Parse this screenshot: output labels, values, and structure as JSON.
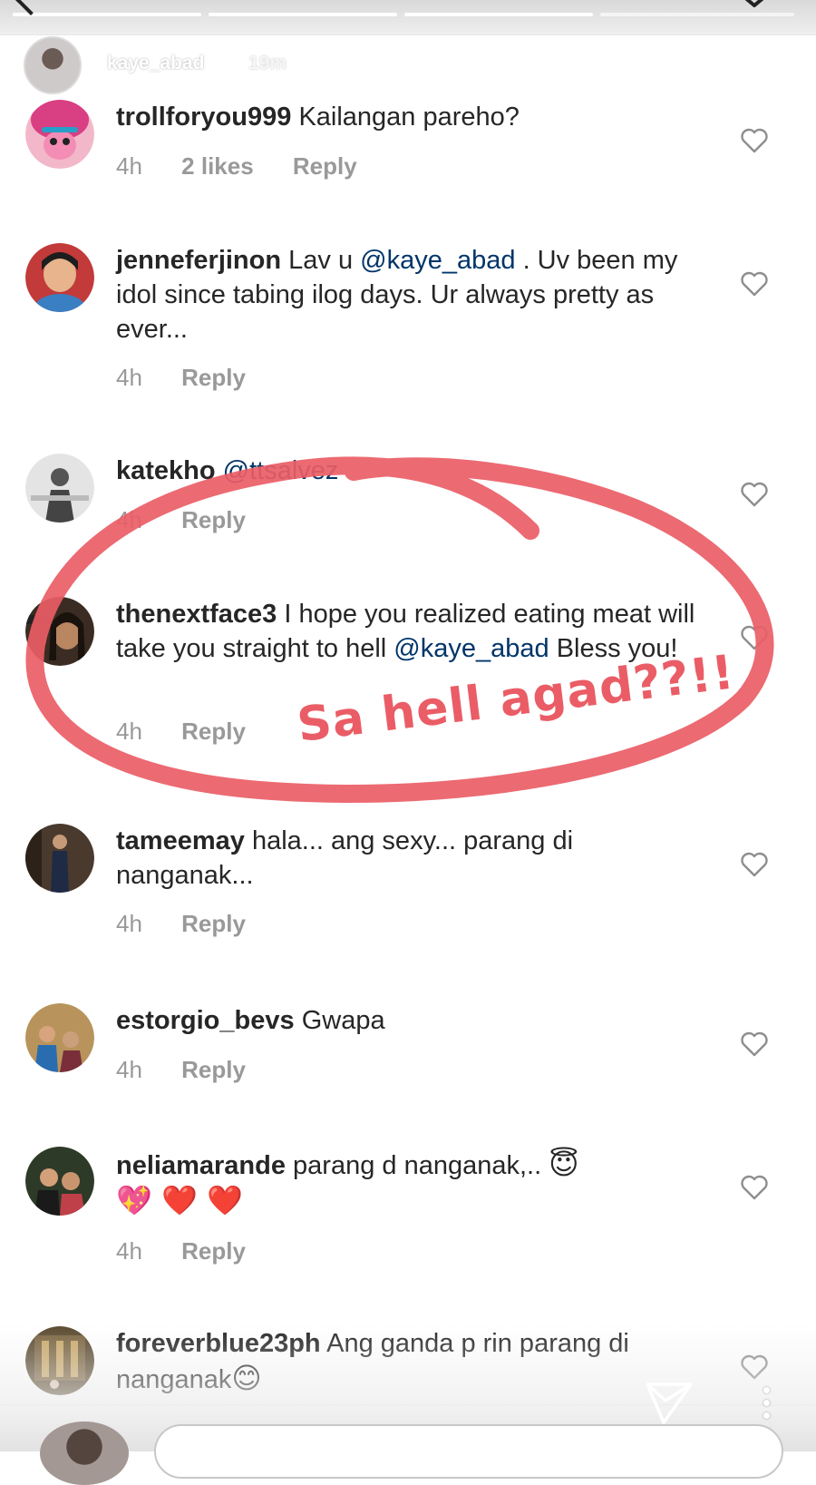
{
  "story": {
    "owner": "kaye_abad",
    "time_ago": "19m"
  },
  "comments": [
    {
      "username": "trollforyou999",
      "text": "Kailangan pareho?",
      "time": "4h",
      "likes": "2 likes",
      "reply": "Reply",
      "avatar_color": "#d94f8a"
    },
    {
      "username": "jenneferjinon",
      "text_before": "Lav u",
      "mention": "@kaye_abad",
      "text_after": ". Uv been my idol since tabing ilog days. Ur always pretty as ever...",
      "time": "4h",
      "reply": "Reply",
      "avatar_color": "#c0393a"
    },
    {
      "username": "katekho",
      "mention": "@ttsalvez",
      "time": "4h",
      "reply": "Reply",
      "avatar_color": "#7a7a7a"
    },
    {
      "username": "thenextface3",
      "text_before": "I hope you realized eating meat will take you straight to hell",
      "mention": "@kaye_abad",
      "text_after": "Bless you!",
      "time": "4h",
      "reply": "Reply",
      "avatar_color": "#4b3a2e"
    },
    {
      "username": "tameemay",
      "text": "hala... ang sexy... parang di nanganak...",
      "time": "4h",
      "reply": "Reply",
      "avatar_color": "#3d2f25"
    },
    {
      "username": "estorgio_bevs",
      "text": "Gwapa",
      "time": "4h",
      "reply": "Reply",
      "avatar_color": "#8a6b3f"
    },
    {
      "username": "neliamarande",
      "text": "parang d nanganak,..",
      "emoji_line": "😇",
      "emoji_line2": "💖 ❤️ ❤️",
      "time": "4h",
      "reply": "Reply",
      "avatar_color": "#2f3b2a"
    },
    {
      "username": "foreverblue23ph",
      "text": "Ang ganda p rin parang di nanganak",
      "emoji": "😊",
      "avatar_color": "#6b5a3a"
    }
  ],
  "annotation": {
    "text": "Sa hell agad??!!",
    "color": "#ea5d66"
  },
  "icons": {
    "like": "heart-outline-icon",
    "send": "send-arrow-icon",
    "more": "more-vertical-icon"
  }
}
